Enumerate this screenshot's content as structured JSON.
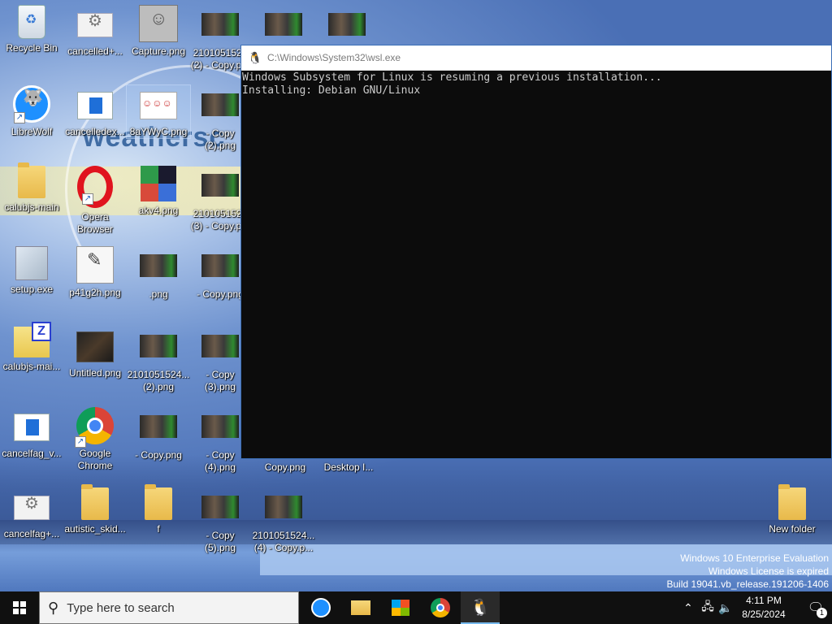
{
  "desktop": {
    "icons": {
      "recycle_bin": "Recycle Bin",
      "cancelled_plus": "cancelled+...",
      "capture": "Capture.png",
      "img_2_copy_top": "2101051524\n(2) - Copy.p...",
      "librewolf": "LibreWolf",
      "cancelledex": "cancelledex...",
      "ayw": "8aYWyC.png",
      "copy_2_png": "- Copy\n(2).png",
      "calubjs_main": "calubjs-main",
      "opera": "Opera\nBrowser",
      "akv4": "akv4.png",
      "img_3_copy": "2101051524\n(3) - Copy.p...",
      "setup": "setup.exe",
      "p41g2h": "p41g2h.png",
      "dotpng": ".png",
      "copy_png": "- Copy.png",
      "calubjs_mai_zip": "calubjs-mai...",
      "untitled": "Untitled.png",
      "img_2_png": "2101051524...\n(2).png",
      "copy_3_png": "- Copy\n(3).png",
      "cancelfag_v": "cancelfag_v...",
      "chrome": "Google\nChrome",
      "copy_png2": "- Copy.png",
      "copy_4_png": "- Copy\n(4).png",
      "copy_png3": "Copy.png",
      "desktop_i": "Desktop I...",
      "cancelfag_plus": "cancelfag+...",
      "autistic_skid": "autistic_skid...",
      "f_folder": "f",
      "copy_5_png": "- Copy\n(5).png",
      "img_4_copy": "2101051524...\n(4) - Copy.p...",
      "new_folder": "New folder"
    }
  },
  "console": {
    "title": "C:\\Windows\\System32\\wsl.exe",
    "lines": "Windows Subsystem for Linux is resuming a previous installation...\nInstalling: Debian GNU/Linux"
  },
  "watermark": {
    "line1": "Windows 10 Enterprise Evaluation",
    "line2": "Windows License is expired",
    "line3": "Build 19041.vb_release.191206-1406"
  },
  "taskbar": {
    "search_placeholder": "Type here to search",
    "time": "4:11 PM",
    "date": "8/25/2024",
    "notification_count": "1",
    "icons": {
      "start": "windows-logo-icon",
      "librewolf": "librewolf-icon",
      "explorer": "folder-icon",
      "store": "store-icon",
      "chrome": "chrome-icon",
      "wsl": "tux-icon"
    }
  },
  "colors": {
    "taskbar": "#101010",
    "console_bg": "#0c0c0c",
    "console_text": "#cccccc",
    "accent": "#76b9ed"
  }
}
